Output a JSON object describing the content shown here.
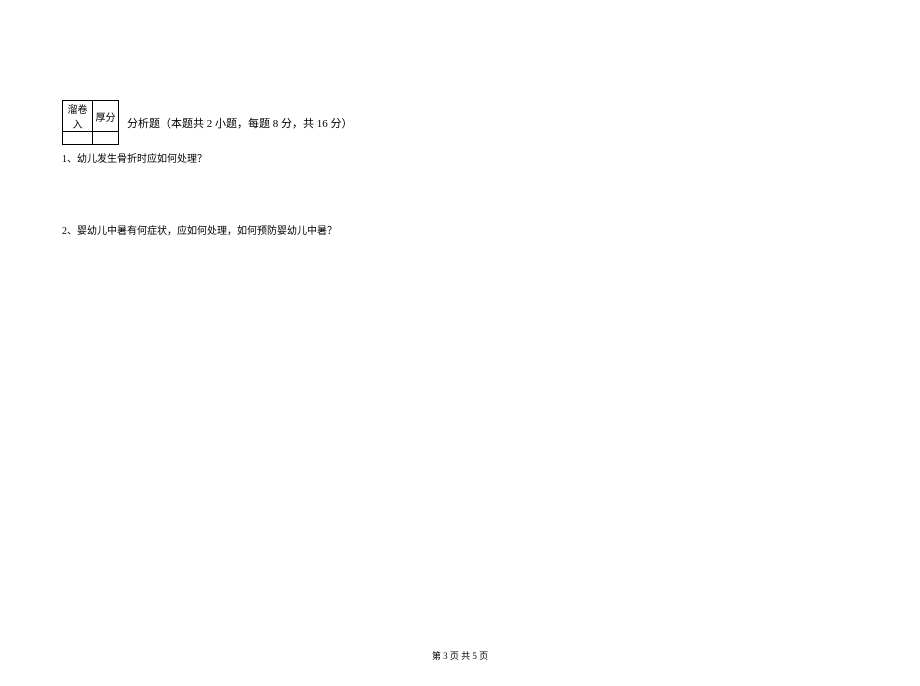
{
  "score_table": {
    "col1": "溜卷入",
    "col2": "厚分"
  },
  "section": {
    "title": "分析题（本题共 2 小题，每题 8 分，共 16 分）"
  },
  "questions": {
    "q1": "1、幼儿发生骨折时应如何处理？",
    "q2": "2、婴幼儿中暑有何症状，应如何处理，如何预防婴幼儿中暑？"
  },
  "footer": {
    "text": "第 3 页 共 5 页"
  }
}
